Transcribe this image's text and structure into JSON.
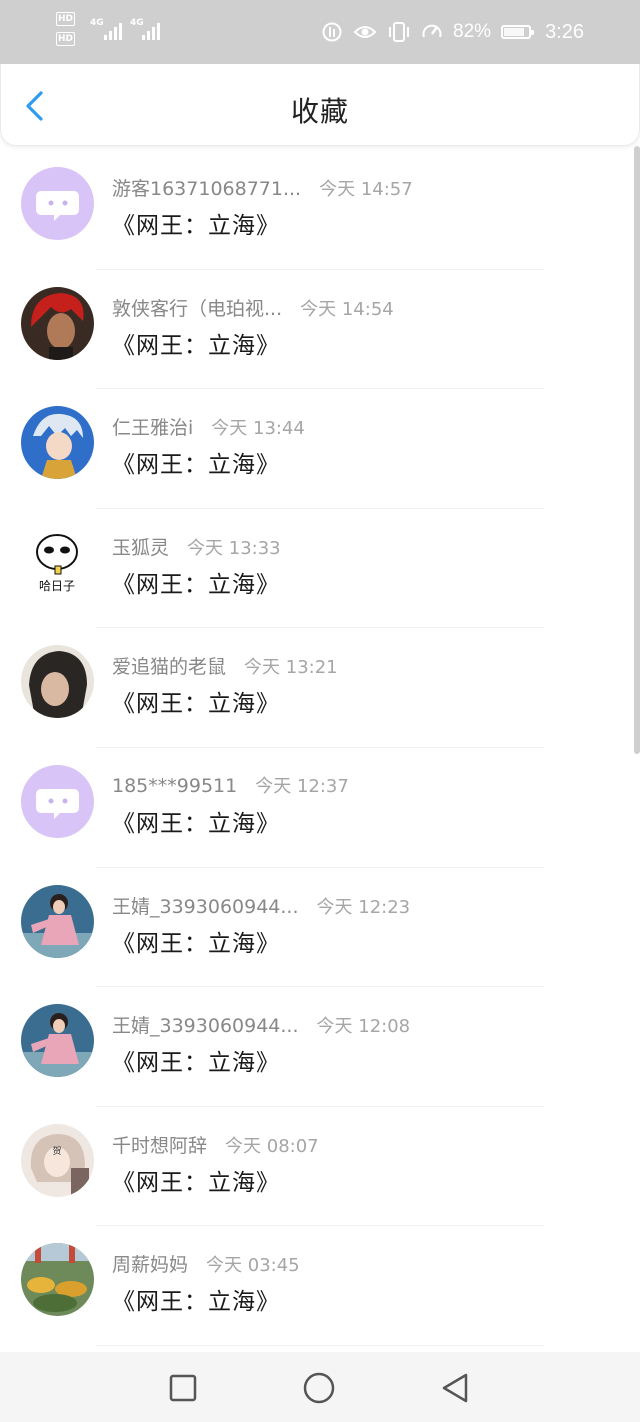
{
  "status_bar": {
    "hd_top": "HD",
    "hd_bottom": "HD",
    "network_1": "4G",
    "network_2": "4G",
    "battery_percent": "82%",
    "battery_level": 0.82,
    "time": "3:26"
  },
  "header": {
    "title": "收藏",
    "back_icon": "chevron-left-icon",
    "accent_color": "#2f9cf0"
  },
  "favorites": [
    {
      "user": "游客16371068771...",
      "time": "今天 14:57",
      "title": "《网王：立海》",
      "avatar": "default-chat-avatar"
    },
    {
      "user": "敦侠客行（电珀视...",
      "time": "今天 14:54",
      "title": "《网王：立海》",
      "avatar": "red-hair-avatar"
    },
    {
      "user": "仁王雅治i",
      "time": "今天 13:44",
      "title": "《网王：立海》",
      "avatar": "anime-boy-avatar"
    },
    {
      "user": "玉狐灵",
      "time": "今天 13:33",
      "title": "《网王：立海》",
      "avatar": "cartoon-face-avatar",
      "avatar_text": "哈日子"
    },
    {
      "user": "爱追猫的老鼠",
      "time": "今天 13:21",
      "title": "《网王：立海》",
      "avatar": "photo-avatar"
    },
    {
      "user": "185***99511",
      "time": "今天 12:37",
      "title": "《网王：立海》",
      "avatar": "default-chat-avatar"
    },
    {
      "user": "王婧_3393060944...",
      "time": "今天 12:23",
      "title": "《网王：立海》",
      "avatar": "girl-photo-avatar"
    },
    {
      "user": "王婧_3393060944...",
      "time": "今天 12:08",
      "title": "《网王：立海》",
      "avatar": "girl-photo-avatar"
    },
    {
      "user": "千时想阿辞",
      "time": "今天 08:07",
      "title": "《网王：立海》",
      "avatar": "anime-sketch-avatar"
    },
    {
      "user": "周薪妈妈",
      "time": "今天 03:45",
      "title": "《网王：立海》",
      "avatar": "flowers-photo-avatar"
    }
  ],
  "nav_bar": {
    "recent_icon": "square-icon",
    "home_icon": "circle-icon",
    "back_icon": "triangle-back-icon"
  }
}
